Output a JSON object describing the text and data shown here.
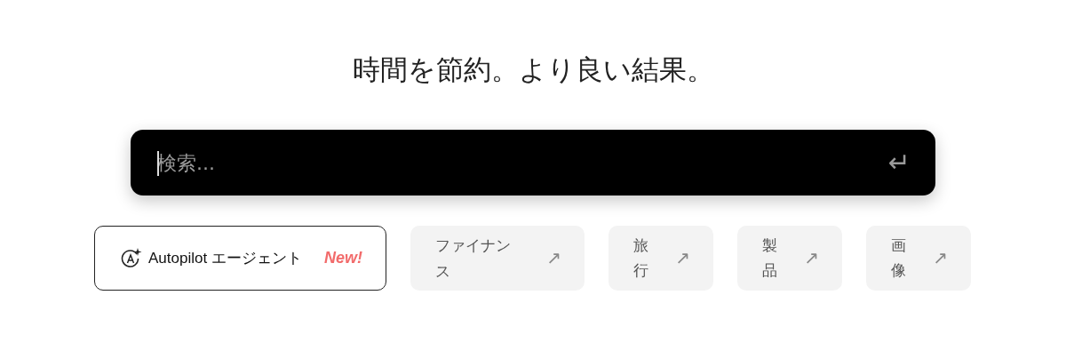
{
  "heading": "時間を節約。より良い結果。",
  "search": {
    "placeholder": "検索...",
    "enter_key": "↵"
  },
  "chips": [
    {
      "kind": "agent",
      "label": "Autopilot エージェント",
      "badge": "New!"
    },
    {
      "kind": "link",
      "label": "ファイナンス",
      "arrow": "↗"
    },
    {
      "kind": "link",
      "label": "旅行",
      "arrow": "↗"
    },
    {
      "kind": "link",
      "label": "製品",
      "arrow": "↗"
    },
    {
      "kind": "link",
      "label": "画像",
      "arrow": "↗"
    }
  ]
}
